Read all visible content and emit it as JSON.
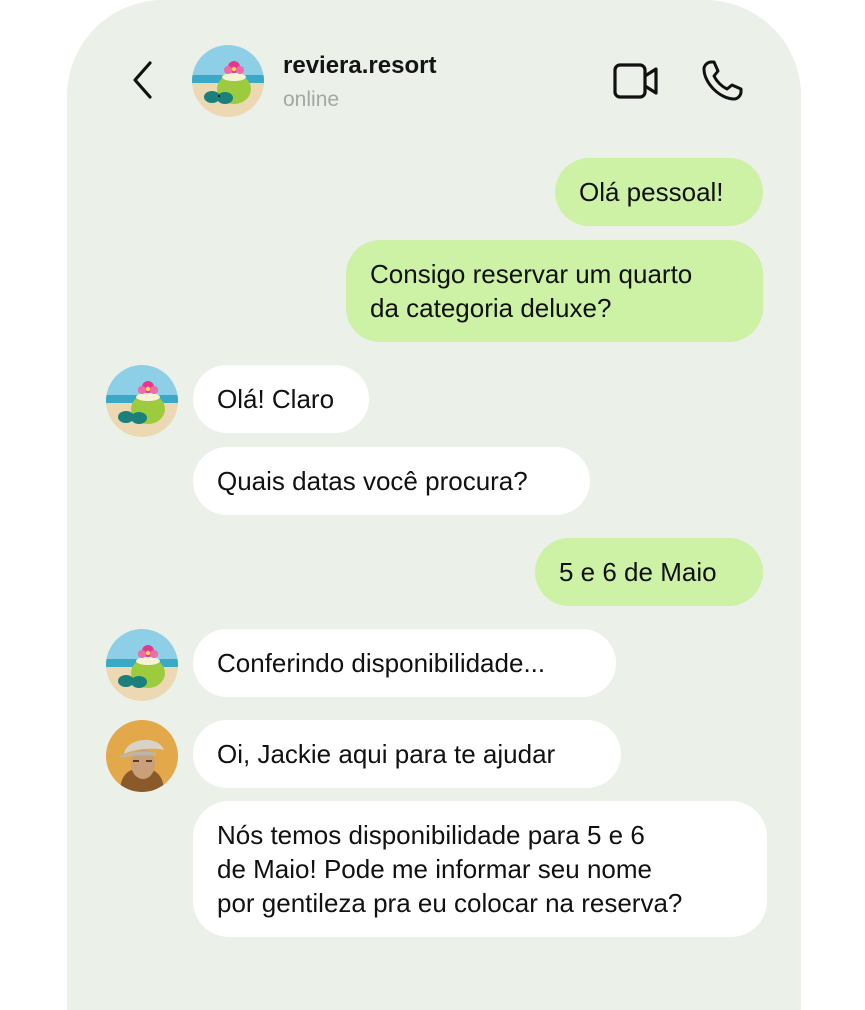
{
  "header": {
    "contact_name": "reviera.resort",
    "status": "online"
  },
  "messages": [
    {
      "direction": "outgoing",
      "text": "Olá pessoal!"
    },
    {
      "direction": "outgoing",
      "lines": [
        "Consigo reservar um quarto",
        "da categoria deluxe?"
      ]
    },
    {
      "direction": "incoming",
      "sender": "resort",
      "text": "Olá! Claro"
    },
    {
      "direction": "incoming",
      "sender": "resort",
      "text": "Quais datas você procura?"
    },
    {
      "direction": "outgoing",
      "text": "5 e 6 de Maio"
    },
    {
      "direction": "incoming",
      "sender": "resort",
      "text": "Conferindo disponibilidade..."
    },
    {
      "direction": "incoming",
      "sender": "jackie",
      "text": "Oi, Jackie aqui para te ajudar"
    },
    {
      "direction": "incoming",
      "sender": "jackie",
      "lines": [
        "Nós temos disponibilidade para 5 e 6",
        "de Maio! Pode me informar seu nome",
        "por gentileza pra eu colocar na reserva?"
      ]
    }
  ],
  "icons": {
    "back": "chevron-left-icon",
    "video": "video-camera-icon",
    "call": "phone-icon"
  },
  "colors": {
    "background": "#ebf0e9",
    "outgoing_bubble": "#cdf1a5",
    "incoming_bubble": "#ffffff",
    "status_text": "#a4a8a4"
  }
}
